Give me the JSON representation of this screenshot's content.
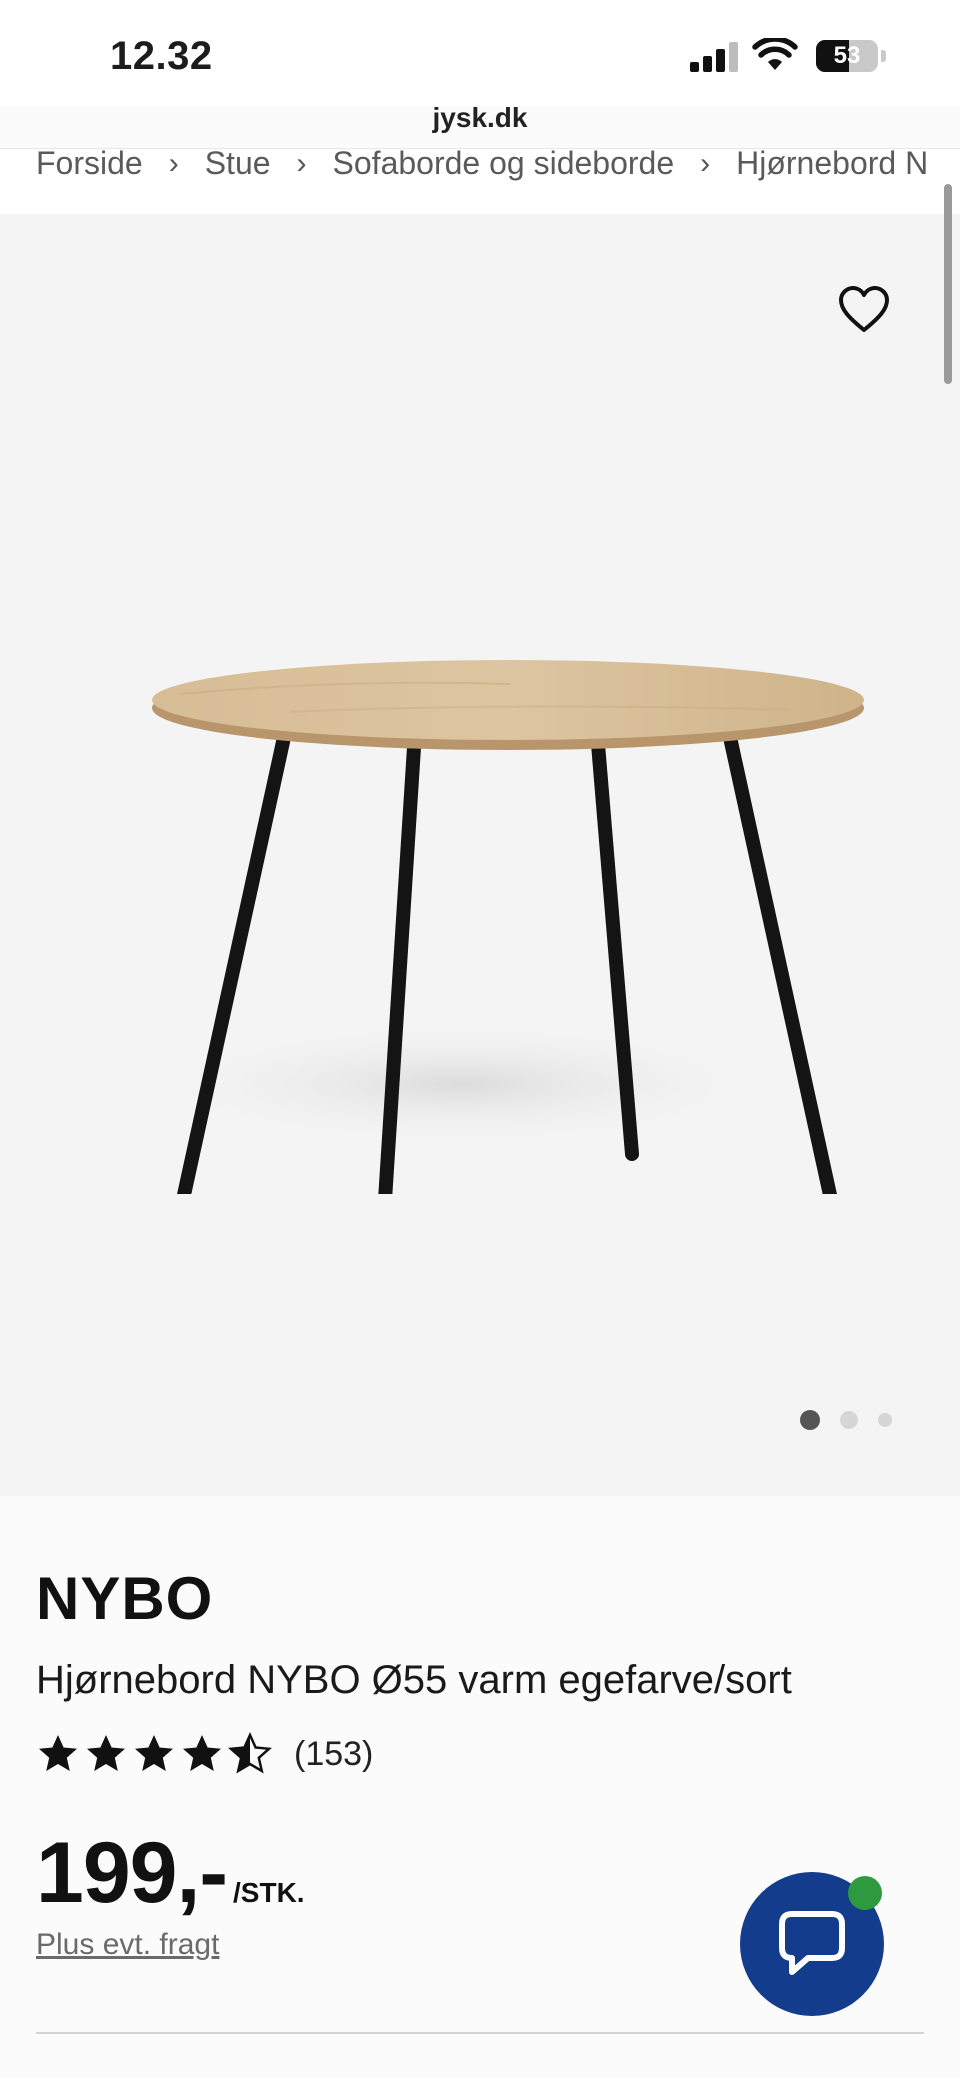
{
  "status_bar": {
    "time": "12.32",
    "battery_level": 53,
    "battery_label": "53"
  },
  "browser": {
    "url": "jysk.dk"
  },
  "breadcrumb": {
    "items": [
      "Forside",
      "Stue",
      "Sofaborde og sideborde",
      "Hjørnebord N"
    ],
    "separator": "›"
  },
  "gallery": {
    "image_count": 3,
    "active_index": 0,
    "wishlist_icon": "heart-outline-icon"
  },
  "product": {
    "brand": "NYBO",
    "name": "Hjørnebord NYBO Ø55 varm egefarve/sort",
    "rating": 4.5,
    "rating_max": 5,
    "review_count": "(153)",
    "price": "199,-",
    "unit": "/STK.",
    "shipping_note": "Plus evt. fragt"
  },
  "chat": {
    "icon": "chat-bubble-icon",
    "status": "online"
  },
  "colors": {
    "brand_blue": "#143c8c",
    "online_green": "#2d9a3f",
    "gallery_bg": "#f4f4f4"
  }
}
